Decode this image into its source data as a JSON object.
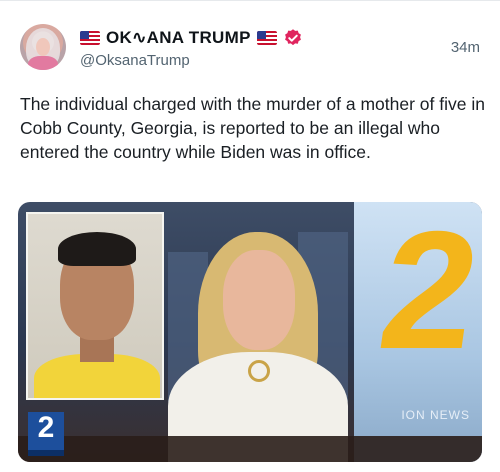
{
  "post": {
    "display_name": "OK∿ANA TRUMP",
    "handle": "@OksanaTrump",
    "timestamp": "34m",
    "flag_icon": "us-flag-icon",
    "verified_icon": "verified-badge-icon",
    "text": "The individual charged with the murder of a mother of five in Cobb County, Georgia, is reported to be an illegal who entered the country while Biden was in office."
  },
  "media": {
    "station_number": "2",
    "station_logo_number": "2",
    "news_label": "ION NEWS"
  },
  "colors": {
    "text": "#0f1419",
    "secondary": "#536471",
    "verified": "#e0245e",
    "station_gold": "#f3b51b",
    "station_blue": "#1d4f9c"
  }
}
